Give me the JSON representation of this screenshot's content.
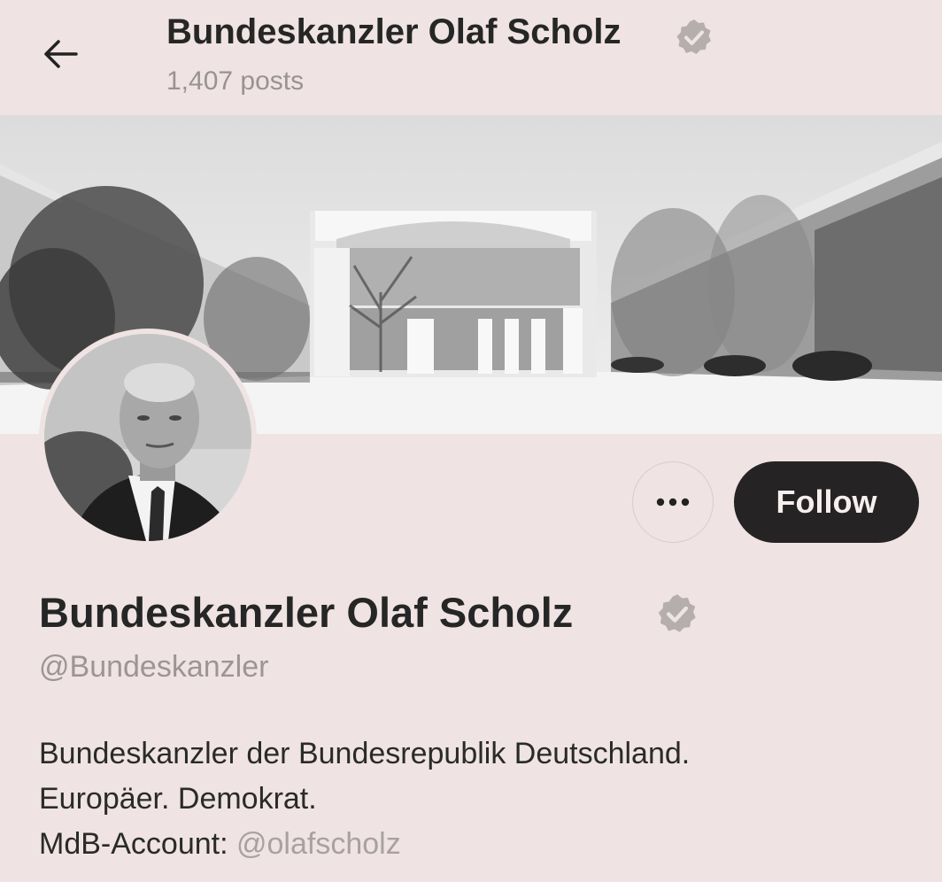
{
  "header": {
    "title": "Bundeskanzler Olaf Scholz",
    "posts_count": "1,407 posts"
  },
  "profile": {
    "display_name": "Bundeskanzler Olaf Scholz",
    "handle": "@Bundeskanzler",
    "bio_lines": [
      "Bundeskanzler der Bundesrepublik Deutschland.",
      "Europäer. Demokrat."
    ],
    "mdb_label": "MdB-Account: ",
    "mdb_mention": "@olafscholz"
  },
  "actions": {
    "more_label": "•••",
    "follow_label": "Follow"
  },
  "icons": {
    "back": "arrow-left-icon",
    "verified": "verified-badge-icon",
    "more": "more-options-icon"
  },
  "colors": {
    "background": "#efe4e3",
    "follow_button": "#252324",
    "muted_text": "#9d9595"
  }
}
